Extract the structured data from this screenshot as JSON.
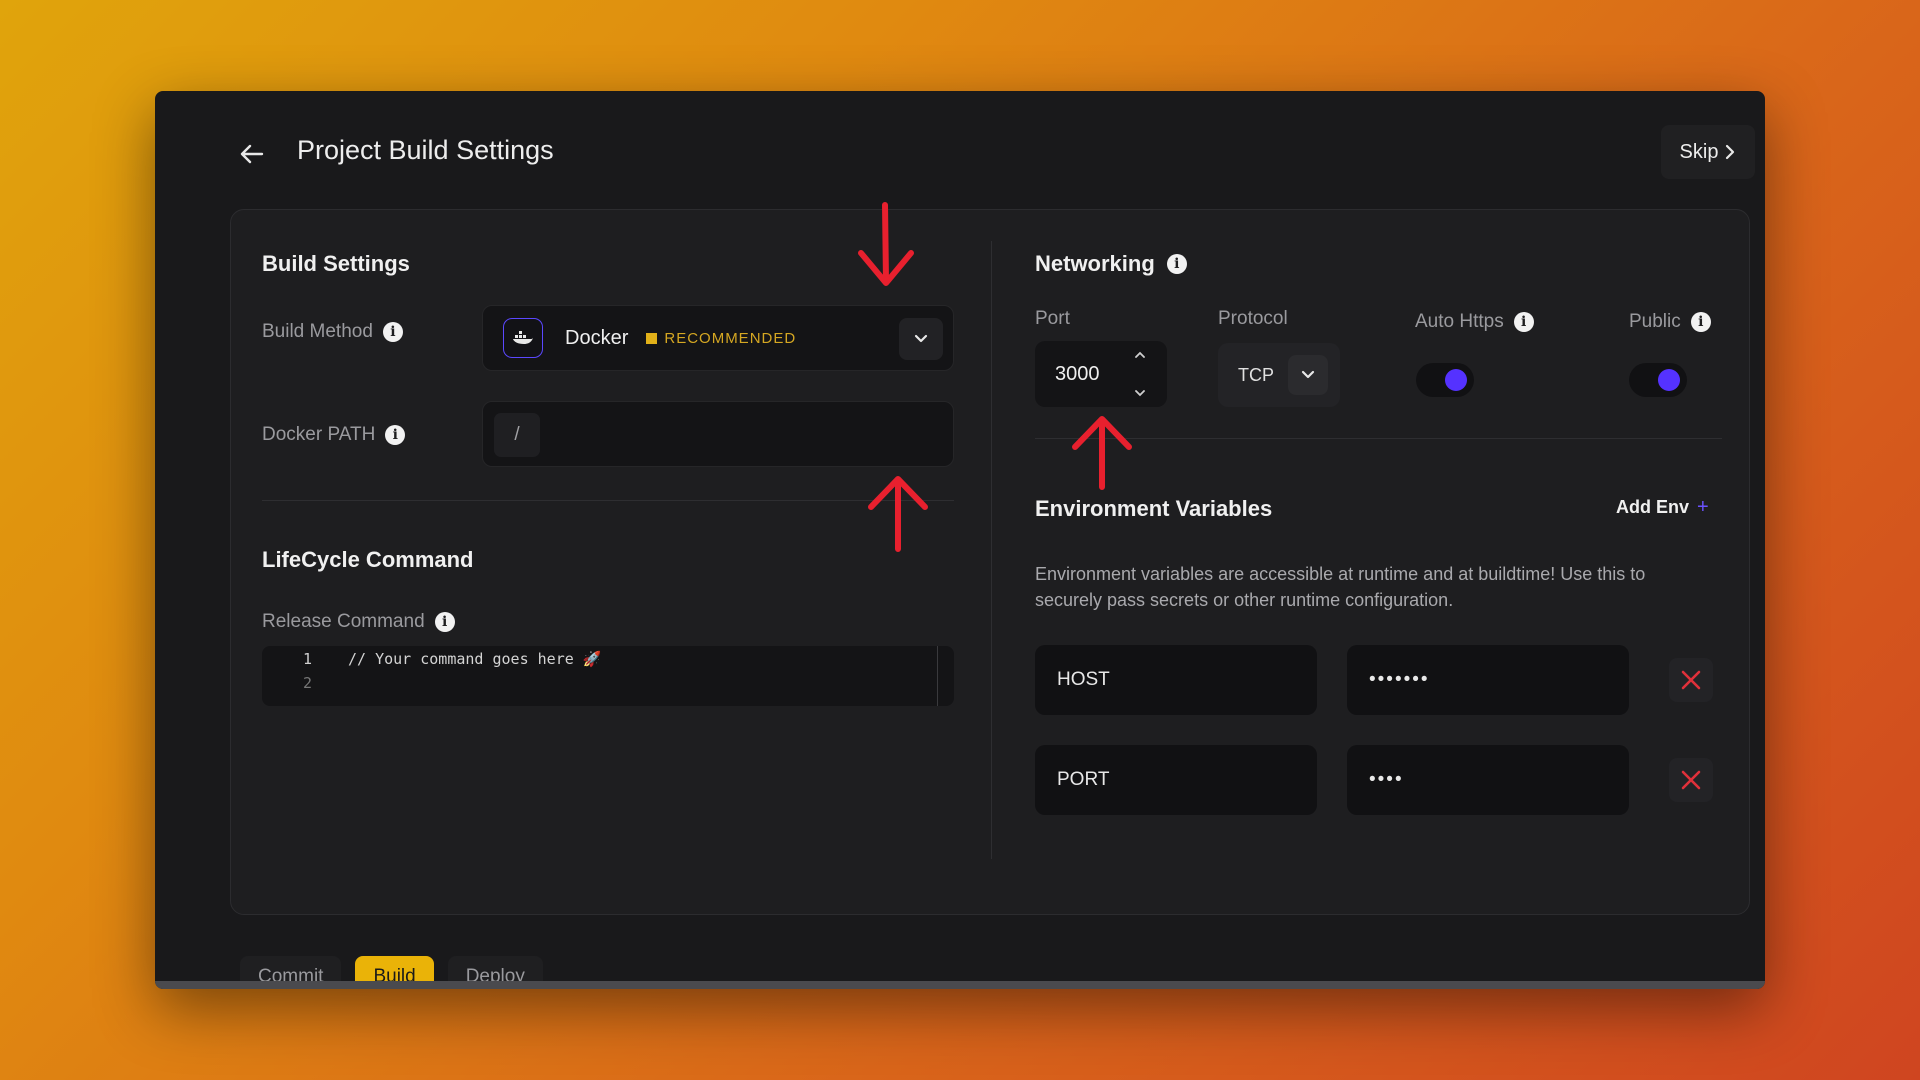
{
  "header": {
    "title": "Project Build Settings",
    "skip_label": "Skip"
  },
  "build": {
    "section_title": "Build Settings",
    "build_method_label": "Build Method",
    "build_method_value": "Docker",
    "recommended_badge": "RECOMMENDED",
    "docker_path_label": "Docker PATH",
    "docker_path_prefix": "/"
  },
  "lifecycle": {
    "section_title": "LifeCycle Command",
    "release_command_label": "Release Command",
    "lines": [
      {
        "number": "1",
        "text": "// Your command goes here 🚀"
      },
      {
        "number": "2",
        "text": ""
      }
    ]
  },
  "networking": {
    "section_title": "Networking",
    "port_label": "Port",
    "port_value": "3000",
    "protocol_label": "Protocol",
    "protocol_value": "TCP",
    "auto_https_label": "Auto Https",
    "auto_https_enabled": true,
    "public_label": "Public",
    "public_enabled": true
  },
  "env": {
    "section_title": "Environment Variables",
    "add_label": "Add Env",
    "description": "Environment variables are accessible at runtime and at buildtime! Use this to securely pass secrets or other runtime configuration.",
    "vars": [
      {
        "key": "HOST",
        "value": "•••••••"
      },
      {
        "key": "PORT",
        "value": "••••"
      }
    ]
  },
  "tabs": [
    {
      "label": "Commit",
      "active": false
    },
    {
      "label": "Build",
      "active": true
    },
    {
      "label": "Deploy",
      "active": false
    }
  ],
  "colors": {
    "accent": "#5532ff",
    "badge": "#e2b119",
    "danger": "#e0303a",
    "annotation": "#e8202e"
  }
}
